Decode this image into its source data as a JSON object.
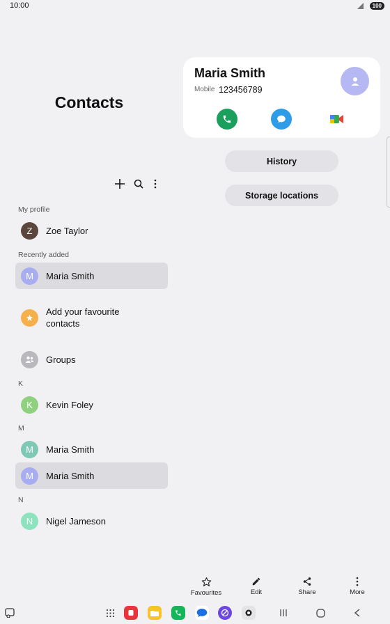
{
  "status_bar": {
    "time": "10:00",
    "battery": "100"
  },
  "left": {
    "title": "Contacts",
    "sections": {
      "my_profile": "My profile",
      "recently_added": "Recently added",
      "k": "K",
      "m": "M",
      "n": "N"
    },
    "rows": {
      "profile": {
        "initial": "Z",
        "name": "Zoe Taylor",
        "color": "#5b463e"
      },
      "recent": {
        "initial": "M",
        "name": "Maria Smith",
        "color": "#a8acf0"
      },
      "favourites": {
        "line1": "Add your favourite",
        "line2": "contacts",
        "color": "#f6b04b"
      },
      "groups": {
        "name": "Groups",
        "color": "#b9b9bd"
      },
      "kevin": {
        "initial": "K",
        "name": "Kevin Foley",
        "color": "#8fd17f"
      },
      "maria1": {
        "initial": "M",
        "name": "Maria Smith",
        "color": "#7ec9b3"
      },
      "maria2": {
        "initial": "M",
        "name": "Maria Smith",
        "color": "#a8acf0"
      },
      "nigel": {
        "initial": "N",
        "name": "Nigel Jameson",
        "color": "#8de3bd"
      }
    }
  },
  "card": {
    "name": "Maria Smith",
    "mobile_label": "Mobile",
    "number": "123456789"
  },
  "buttons": {
    "history": "History",
    "storage": "Storage locations"
  },
  "bottom_actions": {
    "favourites": "Favourites",
    "edit": "Edit",
    "share": "Share",
    "more": "More"
  },
  "colors": {
    "call": "#1aa05c",
    "message": "#2f9ce8",
    "avatar_card": "#b5b8f3"
  }
}
